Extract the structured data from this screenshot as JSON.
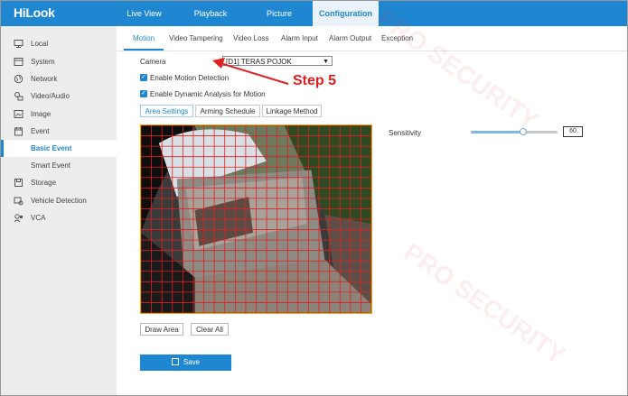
{
  "app": {
    "logo": "HiLook"
  },
  "nav": {
    "tabs": [
      {
        "label": "Live View"
      },
      {
        "label": "Playback"
      },
      {
        "label": "Picture"
      },
      {
        "label": "Configuration"
      }
    ],
    "active": "Configuration"
  },
  "sidebar": {
    "items": [
      {
        "label": "Local",
        "icon": "monitor-icon"
      },
      {
        "label": "System",
        "icon": "system-icon"
      },
      {
        "label": "Network",
        "icon": "globe-icon"
      },
      {
        "label": "Video/Audio",
        "icon": "video-audio-icon"
      },
      {
        "label": "Image",
        "icon": "image-icon"
      },
      {
        "label": "Event",
        "icon": "event-icon"
      },
      {
        "label": "Basic Event",
        "icon": ""
      },
      {
        "label": "Smart Event",
        "icon": ""
      },
      {
        "label": "Storage",
        "icon": "storage-icon"
      },
      {
        "label": "Vehicle Detection",
        "icon": "vehicle-detection-icon"
      },
      {
        "label": "VCA",
        "icon": "vca-icon"
      }
    ],
    "selected": "Basic Event"
  },
  "subtabs": {
    "items": [
      "Motion",
      "Video Tampering",
      "Video Loss",
      "Alarm Input",
      "Alarm Output",
      "Exception"
    ],
    "active": "Motion"
  },
  "form": {
    "camera_label": "Camera",
    "camera_value": "[D1] TERAS POJOK",
    "enable_motion_label": "Enable Motion Detection",
    "enable_motion_checked": true,
    "enable_dynamic_label": "Enable Dynamic Analysis for Motion",
    "enable_dynamic_checked": true
  },
  "inner_tabs": {
    "items": [
      "Area Settings",
      "Arming Schedule",
      "Linkage Method"
    ],
    "active": "Area Settings"
  },
  "sensitivity": {
    "label": "Sensitivity",
    "value": 60
  },
  "buttons": {
    "draw_area": "Draw Area",
    "clear_all": "Clear All",
    "save": "Save"
  },
  "annotation": {
    "text": "Step 5",
    "color": "#e02020"
  },
  "colors": {
    "accent": "#1f86d1",
    "grid": "#e0201e",
    "frame": "#e5a800"
  }
}
